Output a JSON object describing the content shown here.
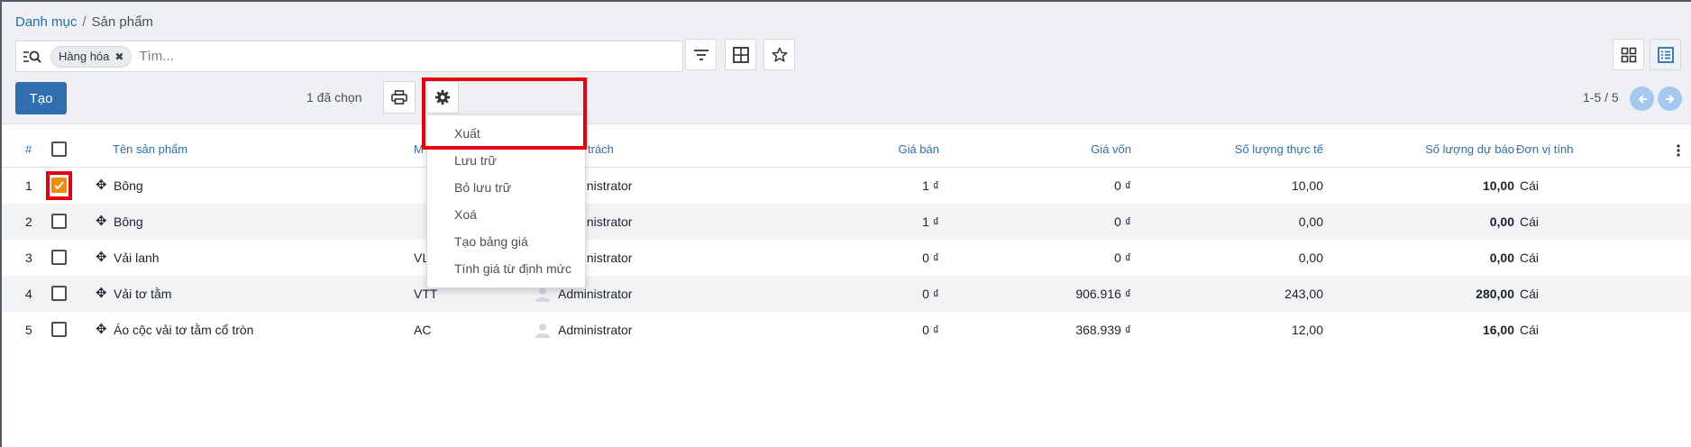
{
  "breadcrumb": {
    "parent": "Danh mục",
    "separator": "/",
    "current": "Sản phẩm"
  },
  "search": {
    "facet": "Hàng hóa",
    "placeholder": "Tìm..."
  },
  "toolbar": {
    "create_label": "Tạo",
    "selected_label": "1 đã chọn"
  },
  "pager": {
    "range": "1-5 / 5"
  },
  "table": {
    "headers": {
      "index": "#",
      "name": "Tên sản phẩm",
      "code": "M",
      "responsible": "trách",
      "price": "Giá bán",
      "cost": "Giá vốn",
      "qty_actual": "Số lượng thực tế",
      "qty_forecast": "Số lượng dự báo",
      "uom": "Đơn vị tính"
    },
    "rows": [
      {
        "index": "1",
        "name": "Bông",
        "code": "",
        "responsible": "Administrator",
        "price": "1 ₫",
        "cost": "0 ₫",
        "qty_actual": "10,00",
        "qty_forecast": "10,00",
        "uom": "Cái",
        "checked": true
      },
      {
        "index": "2",
        "name": "Bông",
        "code": "",
        "responsible": "Administrator",
        "price": "1 ₫",
        "cost": "0 ₫",
        "qty_actual": "0,00",
        "qty_forecast": "0,00",
        "uom": "Cái",
        "checked": false
      },
      {
        "index": "3",
        "name": "Vải lanh",
        "code": "VL",
        "responsible": "Administrator",
        "price": "0 ₫",
        "cost": "0 ₫",
        "qty_actual": "0,00",
        "qty_forecast": "0,00",
        "uom": "Cái",
        "checked": false
      },
      {
        "index": "4",
        "name": "Vải tơ tằm",
        "code": "VTT",
        "responsible": "Administrator",
        "price": "0 ₫",
        "cost": "906.916 ₫",
        "qty_actual": "243,00",
        "qty_forecast": "280,00",
        "uom": "Cái",
        "checked": false
      },
      {
        "index": "5",
        "name": "Áo cộc vải tơ tằm cổ tròn",
        "code": "AC",
        "responsible": "Administrator",
        "price": "0 ₫",
        "cost": "368.939 ₫",
        "qty_actual": "12,00",
        "qty_forecast": "16,00",
        "uom": "Cái",
        "checked": false
      }
    ]
  },
  "action_menu": {
    "items": [
      "Xuất",
      "Lưu trữ",
      "Bỏ lưu trữ",
      "Xoá",
      "Tạo bảng giá",
      "Tính giá từ định mức"
    ]
  },
  "colors": {
    "primary": "#2f6faf",
    "highlight": "#e8000f",
    "checked": "#f28b00"
  },
  "icons": [
    "search-icon",
    "close-icon",
    "filter-icon",
    "group-by-icon",
    "star-icon",
    "kanban-view-icon",
    "list-view-icon",
    "print-icon",
    "gear-icon",
    "chevron-left-icon",
    "chevron-right-icon",
    "drag-handle-icon",
    "avatar-icon",
    "column-options-icon"
  ]
}
